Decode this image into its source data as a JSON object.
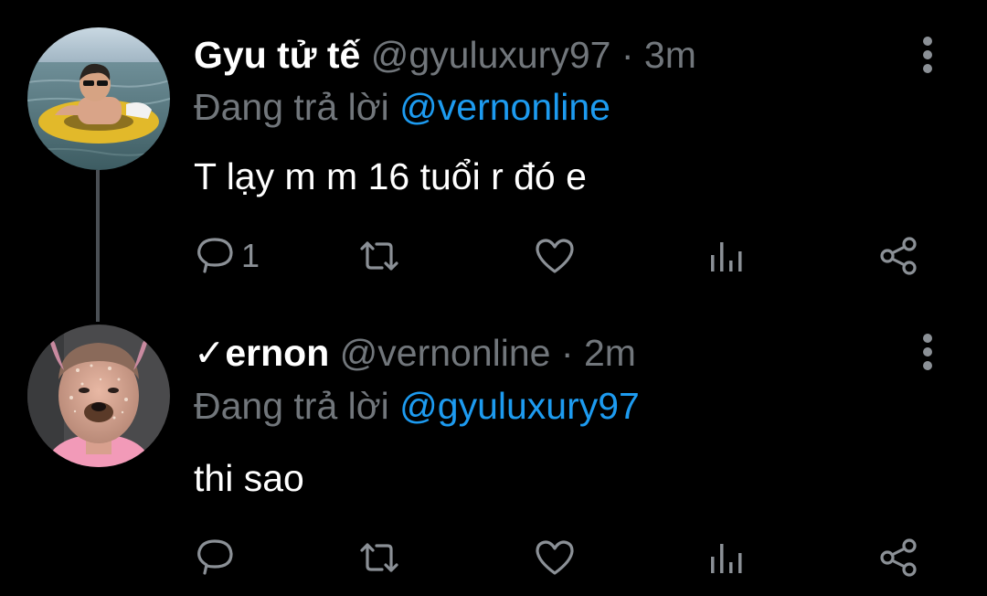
{
  "colors": {
    "background": "#000000",
    "text": "#ffffff",
    "secondary": "#71767b",
    "link": "#1d9bf0",
    "icon": "#8b9096"
  },
  "tweets": [
    {
      "name": "Gyu tử tế",
      "handle": "@gyuluxury97",
      "separator": "·",
      "time": "3m",
      "reply_prefix": "Đang trả lời",
      "reply_to": "@vernonline",
      "text": "T lạy m m 16 tuổi r đó e",
      "reply_count": "1",
      "avatar": "avatar-man-in-pool-float",
      "icons": [
        "reply-icon",
        "retweet-icon",
        "like-icon",
        "analytics-icon",
        "share-icon",
        "more-icon"
      ]
    },
    {
      "name": "✓ernon",
      "handle": "@vernonline",
      "separator": "·",
      "time": "2m",
      "reply_prefix": "Đang trả lời",
      "reply_to": "@gyuluxury97",
      "text": "thi sao",
      "reply_count": "",
      "avatar": "avatar-sparkle-dog-filter-selfie",
      "icons": [
        "reply-icon",
        "retweet-icon",
        "like-icon",
        "analytics-icon",
        "share-icon",
        "more-icon"
      ]
    }
  ]
}
